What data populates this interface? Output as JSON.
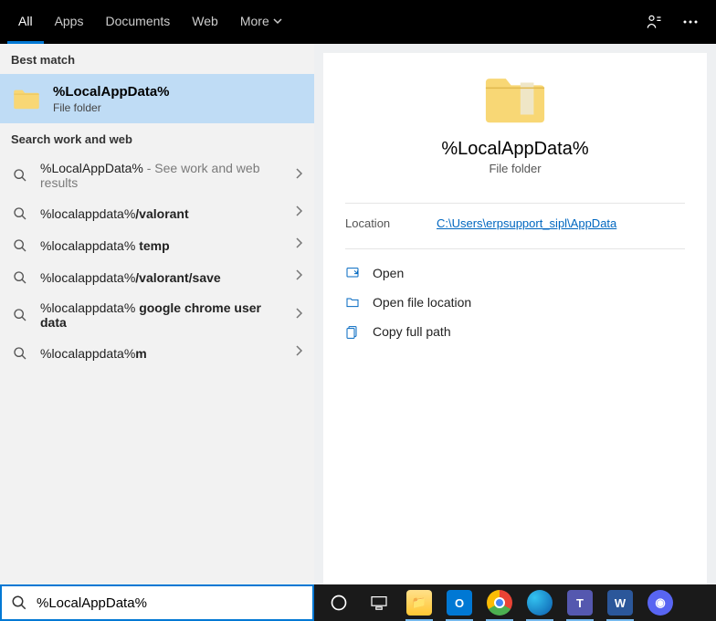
{
  "tabs": {
    "all": "All",
    "apps": "Apps",
    "documents": "Documents",
    "web": "Web",
    "more": "More"
  },
  "sections": {
    "best_match": "Best match",
    "search_web": "Search work and web"
  },
  "best_match": {
    "title": "%LocalAppData%",
    "subtitle": "File folder"
  },
  "suggestions": [
    {
      "prefix": "%LocalAppData%",
      "bold": "",
      "hint": " - See work and web results"
    },
    {
      "prefix": "%localappdata%",
      "bold": "/valorant",
      "hint": ""
    },
    {
      "prefix": "%localappdata% ",
      "bold": "temp",
      "hint": ""
    },
    {
      "prefix": "%localappdata%",
      "bold": "/valorant/save",
      "hint": ""
    },
    {
      "prefix": "%localappdata% ",
      "bold": "google chrome user data",
      "hint": ""
    },
    {
      "prefix": "%localappdata%",
      "bold": "m",
      "hint": ""
    }
  ],
  "details": {
    "title": "%LocalAppData%",
    "subtitle": "File folder",
    "location_label": "Location",
    "location_value": "C:\\Users\\erpsupport_sipl\\AppData",
    "actions": {
      "open": "Open",
      "open_loc": "Open file location",
      "copy_path": "Copy full path"
    }
  },
  "search_input": {
    "value": "%LocalAppData%"
  }
}
